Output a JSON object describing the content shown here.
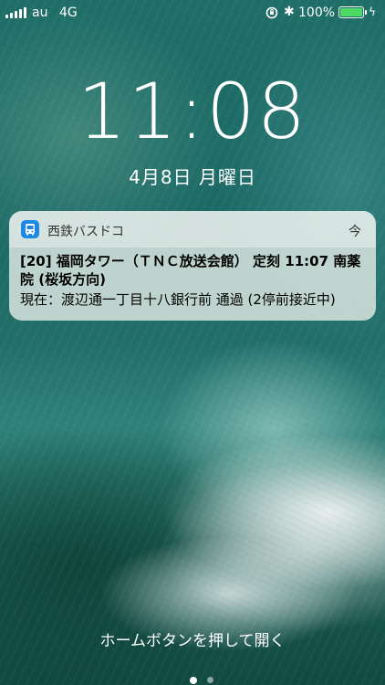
{
  "status_bar": {
    "carrier": "au",
    "network": "4G",
    "bluetooth_glyph": "✱",
    "battery_percent": "100%",
    "battery_level": 1.0,
    "charging_glyph": "ϟ",
    "colors": {
      "battery_fill": "#4cd964"
    }
  },
  "lock_screen": {
    "time": "11:08",
    "date": "4月8日 月曜日",
    "home_hint": "ホームボタンを押して開く"
  },
  "notification": {
    "app_icon": "bus-icon",
    "app_name": "西鉄バスドコ",
    "time": "今",
    "title": "[20] 福岡タワー（ＴＮＣ放送会館） 定刻 11:07 南薬院 (桜坂方向)",
    "body": "現在：渡辺通一丁目十八銀行前 通過 (2停前接近中)"
  },
  "page_indicator": {
    "page_count": 2,
    "active_page": 1
  }
}
